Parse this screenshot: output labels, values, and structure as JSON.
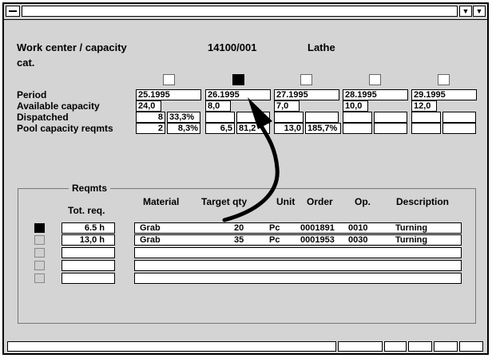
{
  "titlebar": {
    "title": "",
    "buttons": [
      "chevron-down-icon",
      "chevron-down-icon"
    ]
  },
  "header": {
    "label": "Work center / capacity",
    "label2": "cat.",
    "code": "14100/001",
    "name": "Lathe"
  },
  "periods": {
    "label": "Period",
    "values": [
      "25.1995",
      "26.1995",
      "27.1995",
      "28.1995",
      "29.1995"
    ],
    "selected_index": 1
  },
  "available": {
    "label": "Available capacity",
    "values": [
      "24,0",
      "8,0",
      "7,0",
      "10,0",
      "12,0"
    ]
  },
  "dispatched": {
    "label": "Dispatched",
    "values": [
      "8",
      "",
      "",
      "",
      ""
    ],
    "percents": [
      "33,3%",
      "",
      "",
      "",
      ""
    ]
  },
  "pool": {
    "label": "Pool capacity reqmts",
    "values": [
      "2",
      "6,5",
      "13,0",
      "",
      ""
    ],
    "percents": [
      "8,3%",
      "81,2",
      "185,7%",
      "",
      ""
    ]
  },
  "reqmts": {
    "group_title": "Reqmts",
    "columns": {
      "tot_req": "Tot. req.",
      "material": "Material",
      "target_qty": "Target qty",
      "unit": "Unit",
      "order": "Order",
      "op": "Op.",
      "description": "Description"
    },
    "rows": [
      {
        "tot": "6.5 h",
        "material": "Grab",
        "qty": "20",
        "unit": "Pc",
        "order": "0001891",
        "op": "0010",
        "description": "Turning",
        "selected": true
      },
      {
        "tot": "13,0 h",
        "material": "Grab",
        "qty": "35",
        "unit": "Pc",
        "order": "0001953",
        "op": "0030",
        "description": "Turning",
        "selected": false
      },
      {
        "tot": "",
        "material": "",
        "qty": "",
        "unit": "",
        "order": "",
        "op": "",
        "description": "",
        "selected": false
      },
      {
        "tot": "",
        "material": "",
        "qty": "",
        "unit": "",
        "order": "",
        "op": "",
        "description": "",
        "selected": false
      },
      {
        "tot": "",
        "material": "",
        "qty": "",
        "unit": "",
        "order": "",
        "op": "",
        "description": "",
        "selected": false
      }
    ]
  }
}
